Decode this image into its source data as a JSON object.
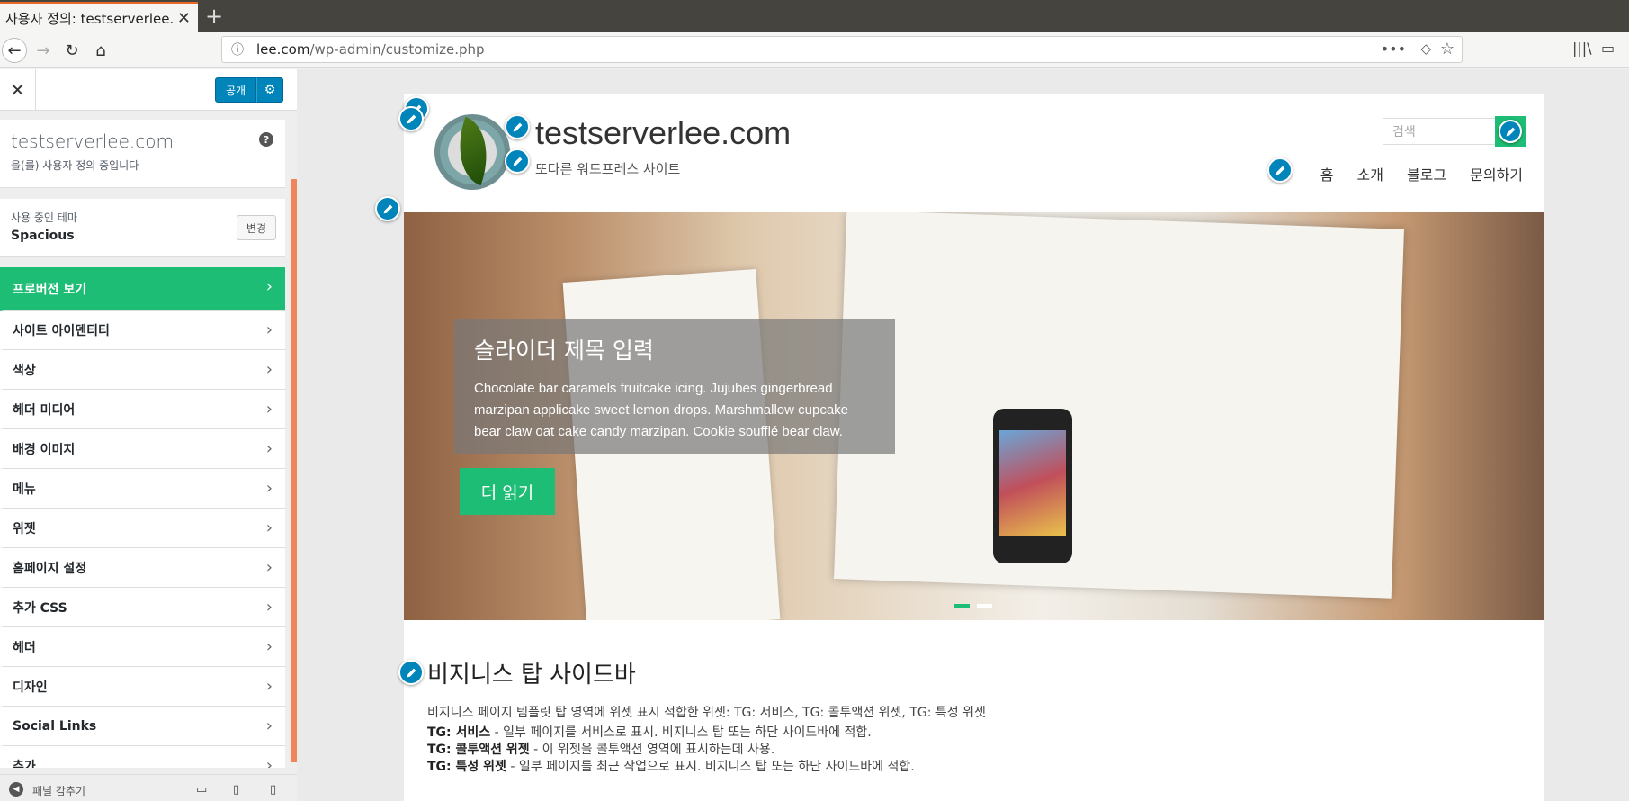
{
  "browser": {
    "tab_title": "사용자 정의: testserverlee.co",
    "url_host": "lee.com",
    "url_path": "/wp-admin/customize.php"
  },
  "customizer": {
    "publish_label": "공개",
    "site_name": "testserverlee.com",
    "site_subtitle": "을(를) 사용자 정의 중입니다",
    "theme_label": "사용 중인 테마",
    "theme_name": "Spacious",
    "change_label": "변경",
    "menu": [
      {
        "label": "프로버전 보기"
      },
      {
        "label": "사이트 아이덴티티"
      },
      {
        "label": "색상"
      },
      {
        "label": "헤더 미디어"
      },
      {
        "label": "배경 이미지"
      },
      {
        "label": "메뉴"
      },
      {
        "label": "위젯"
      },
      {
        "label": "홈페이지 설정"
      },
      {
        "label": "추가 CSS"
      },
      {
        "label": "헤더"
      },
      {
        "label": "디자인"
      },
      {
        "label": "Social Links"
      },
      {
        "label": "추가"
      }
    ],
    "collapse_label": "패널 감추기"
  },
  "preview": {
    "site_title": "testserverlee.com",
    "tagline": "또다른 워드프레스 사이트",
    "search_placeholder": "검색",
    "nav": [
      "홈",
      "소개",
      "블로그",
      "문의하기"
    ],
    "slide": {
      "title": "슬라이더 제목 입력",
      "desc": "Chocolate bar caramels fruitcake icing. Jujubes gingerbread marzipan applicake sweet lemon drops. Marshmallow cupcake bear claw oat cake candy marzipan. Cookie soufflé bear claw.",
      "button": "더 읽기"
    },
    "business": {
      "title": "비지니스 탑 사이드바",
      "intro": "비지니스 페이지 템플릿 탑 영역에 위젯 표시 적합한 위젯: TG: 서비스, TG: 콜투액션 위젯, TG: 특성 위젯",
      "items": [
        {
          "name": "TG: 서비스",
          "desc": " - 일부 페이지를 서비스로 표시. 비지니스 탑 또는 하단 사이드바에 적합."
        },
        {
          "name": "TG: 콜투액션 위젯",
          "desc": " - 이 위젯을 콜투액션 영역에 표시하는데 사용."
        },
        {
          "name": "TG: 특성 위젯",
          "desc": " - 일부 페이지를 최근 작업으로 표시. 비지니스 탑 또는 하단 사이드바에 적합."
        }
      ]
    }
  },
  "colors": {
    "accent": "#1ebd75",
    "wp_blue": "#0085ba",
    "scroll_indicator": "#f0845b"
  }
}
